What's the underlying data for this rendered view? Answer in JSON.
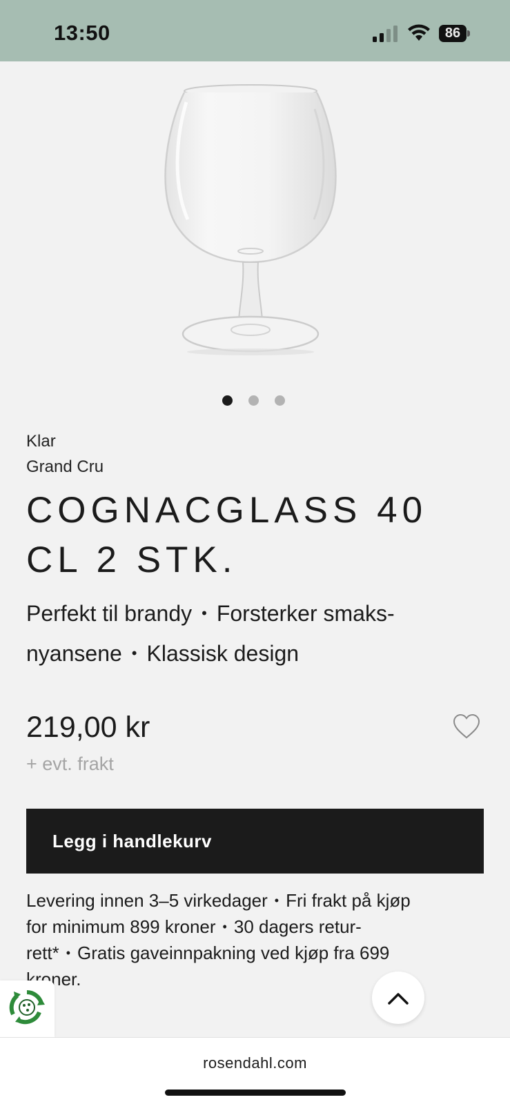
{
  "status_bar": {
    "time": "13:50",
    "battery_level": "86",
    "signal_bars_active": 2,
    "signal_bars_total": 4
  },
  "gallery": {
    "image_count": 3,
    "active_index": 0
  },
  "product": {
    "color": "Klar",
    "collection": "Grand Cru",
    "title_line1": "COGNACGLASS 40",
    "title_line2": "CL 2 STK.",
    "usp_1": "Perfekt til brandy",
    "usp_2": "Forsterker smaks-",
    "usp_2b": "nyansene",
    "usp_3": "Klassisk design",
    "bullet": "•",
    "price": "219,00 kr",
    "shipping_note": "+ evt. frakt",
    "favorite_icon": "heart-outline-icon"
  },
  "cart": {
    "add_label": "Legg i handlekurv"
  },
  "delivery": {
    "line1_a": "Levering innen 3–5 virkedager",
    "line1_b": "Fri frakt på kjøp",
    "line2_a": "for minimum 899 kroner",
    "line2_b": "30 dagers retur-",
    "line3_a": "rett*",
    "line3_b": "Gratis gaveinnpakning ved kjøp fra 699",
    "line4": "kroner."
  },
  "floating": {
    "eco_icon": "recycle-badge-icon",
    "scroll_top_icon": "chevron-up-icon"
  },
  "browser": {
    "url": "rosendahl.com"
  },
  "colors": {
    "status_bar_bg": "#a6bdb2",
    "page_bg": "#f2f2f2",
    "button_bg": "#1b1b1b",
    "eco_green": "#2e8b3a"
  }
}
